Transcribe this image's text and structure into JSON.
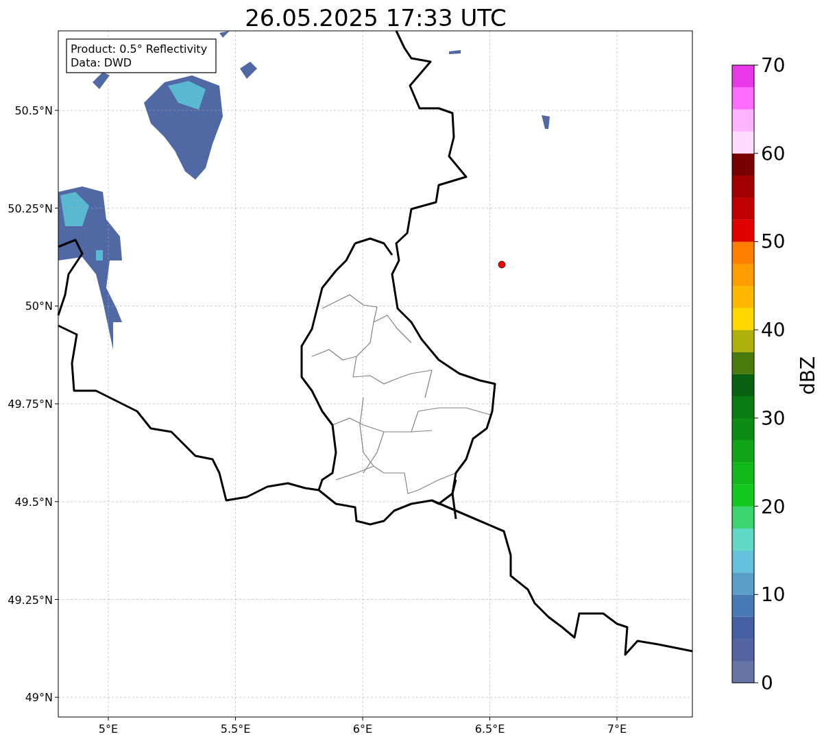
{
  "title": "26.05.2025 17:33 UTC",
  "info_box": [
    "Product: 0.5° Reflectivity",
    "Data: DWD"
  ],
  "map": {
    "lat_ticks": [
      "50.5°N",
      "50.25°N",
      "50°N",
      "49.75°N",
      "49.5°N",
      "49.25°N",
      "49°N"
    ],
    "lon_ticks": [
      "5°E",
      "5.5°E",
      "6°E",
      "6.5°E",
      "7°E"
    ]
  },
  "colorbar": {
    "label": "dBZ",
    "ticks": [
      "70",
      "60",
      "50",
      "40",
      "30",
      "20",
      "10",
      "0"
    ],
    "bins": [
      {
        "color": "#6674a6"
      },
      {
        "color": "#5464a0"
      },
      {
        "color": "#4460a2"
      },
      {
        "color": "#4a7ab5"
      },
      {
        "color": "#5a9ec8"
      },
      {
        "color": "#66c2dc"
      },
      {
        "color": "#62d8c6"
      },
      {
        "color": "#3cd46e"
      },
      {
        "color": "#12c81e"
      },
      {
        "color": "#12b81a"
      },
      {
        "color": "#10a418"
      },
      {
        "color": "#0c8c14"
      },
      {
        "color": "#0a7a12"
      },
      {
        "color": "#086010"
      },
      {
        "color": "#4a7a0c"
      },
      {
        "color": "#b0b00a"
      },
      {
        "color": "#ffd800"
      },
      {
        "color": "#ffb800"
      },
      {
        "color": "#ff9c00"
      },
      {
        "color": "#ff7e00"
      },
      {
        "color": "#e00000"
      },
      {
        "color": "#c00000"
      },
      {
        "color": "#a00000"
      },
      {
        "color": "#780000"
      },
      {
        "color": "#ffdcff"
      },
      {
        "color": "#ffb4ff"
      },
      {
        "color": "#ff6cff"
      },
      {
        "color": "#e838e8"
      }
    ]
  }
}
